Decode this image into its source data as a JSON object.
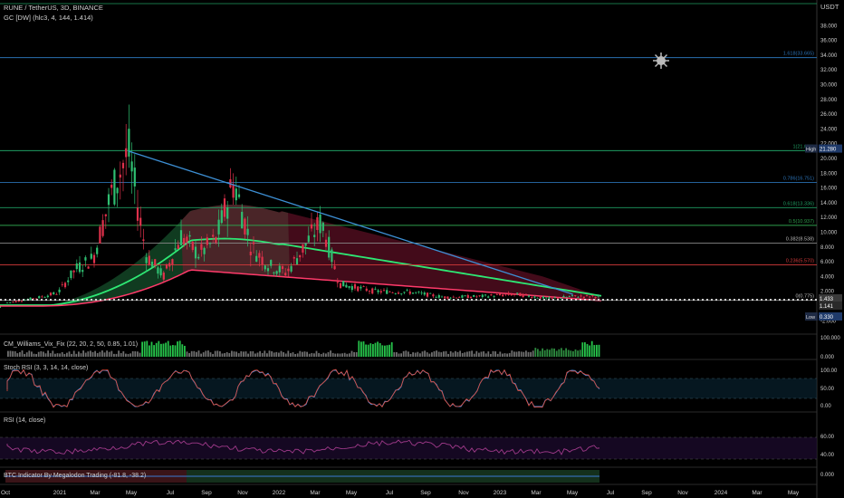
{
  "header": {
    "symbol_line": "RUNE / TetherUS, 3D, BINANCE",
    "indicator_line": "GC [DW] (hlc3, 4, 144, 1.414)"
  },
  "currency": "USDT",
  "colors": {
    "background": "#000000",
    "candle_up": "#2fbf71",
    "candle_down": "#e0314b",
    "trendline": "#3d8fd4",
    "band_green": "#2ee874",
    "band_red": "#ff3a6a"
  },
  "chart_data": [
    {
      "type": "candlestick",
      "title": "RUNE / TetherUS, 3D, BINANCE",
      "y_ticks": [
        "40.000",
        "38.000",
        "36.000",
        "34.000",
        "32.000",
        "30.000",
        "28.000",
        "26.000",
        "24.000",
        "22.000",
        "20.000",
        "18.000",
        "16.000",
        "14.000",
        "12.000",
        "10.000",
        "8.000",
        "6.000",
        "4.000",
        "2.000",
        "0.000",
        "-2.000"
      ],
      "ylim": [
        -2,
        41
      ],
      "x_ticks": [
        "Oct",
        "2021",
        "Mar",
        "May",
        "Jul",
        "Sep",
        "Nov",
        "2022",
        "Mar",
        "May",
        "Jul",
        "Sep",
        "Nov",
        "2023",
        "Mar",
        "May",
        "Jul",
        "Sep",
        "Nov",
        "2024",
        "Mar",
        "May"
      ],
      "approx_close_path": [
        {
          "t": "Oct 2020",
          "v": 0.4
        },
        {
          "t": "Dec 2020",
          "v": 1.2
        },
        {
          "t": "Jan 2021",
          "v": 1.8
        },
        {
          "t": "Feb 2021",
          "v": 5.0
        },
        {
          "t": "Mar 2021",
          "v": 6.5
        },
        {
          "t": "Apr 2021",
          "v": 15.0
        },
        {
          "t": "May 2021",
          "v": 21.0
        },
        {
          "t": "Jun 2021",
          "v": 7.0
        },
        {
          "t": "Jul 2021",
          "v": 4.0
        },
        {
          "t": "Aug 2021",
          "v": 9.5
        },
        {
          "t": "Sep 2021",
          "v": 7.0
        },
        {
          "t": "Oct 2021",
          "v": 9.0
        },
        {
          "t": "Nov 2021",
          "v": 17.0
        },
        {
          "t": "Dec 2021",
          "v": 8.0
        },
        {
          "t": "Jan 2022",
          "v": 5.5
        },
        {
          "t": "Feb 2022",
          "v": 4.5
        },
        {
          "t": "Mar 2022",
          "v": 8.0
        },
        {
          "t": "Apr 2022",
          "v": 11.5
        },
        {
          "t": "May 2022",
          "v": 3.0
        },
        {
          "t": "Jul 2022",
          "v": 2.0
        },
        {
          "t": "Sep 2022",
          "v": 1.9
        },
        {
          "t": "Nov 2022",
          "v": 1.2
        },
        {
          "t": "Jan 2023",
          "v": 1.3
        },
        {
          "t": "Mar 2023",
          "v": 1.6
        },
        {
          "t": "May 2023",
          "v": 1.0
        },
        {
          "t": "Jun 2023",
          "v": 1.3
        }
      ],
      "fib_levels": [
        {
          "label": "1.618(33.665)",
          "value": 33.665,
          "color": "#2a6fb0"
        },
        {
          "label": "1(21.059)",
          "value": 21.059,
          "color": "#1f9d62"
        },
        {
          "label": "0.786(16.751)",
          "value": 16.751,
          "color": "#2a6fb0"
        },
        {
          "label": "0.618(13.336)",
          "value": 13.336,
          "color": "#1f9d62"
        },
        {
          "label": "0.5(10.937)",
          "value": 10.937,
          "color": "#2e9e4c"
        },
        {
          "label": "0.382(8.538)",
          "value": 8.538,
          "color": "#888888"
        },
        {
          "label": "0.236(5.570)",
          "value": 5.57,
          "color": "#d43a3a"
        },
        {
          "label": "0(0.775)",
          "value": 0.775,
          "color": "#888888"
        }
      ],
      "price_tags": [
        {
          "name": "High",
          "value": "21.280"
        },
        {
          "name": "Low",
          "value": "0.330"
        },
        {
          "name": "Last",
          "value": "1.433"
        },
        {
          "name": "Last2",
          "value": "1.141"
        }
      ],
      "trendline": [
        {
          "t": "May 2021",
          "v": 21.0
        },
        {
          "t": "Jun 2023",
          "v": 1.6
        }
      ]
    },
    {
      "type": "bar",
      "title": "CM_Williams_Vix_Fix (22, 20, 2, 50, 0.85, 1.01)",
      "y_ticks": [
        "100.000",
        "0.000"
      ],
      "ylim": [
        0,
        100
      ]
    },
    {
      "type": "line",
      "title": "Stoch RSI (3, 3, 14, 14, close)",
      "y_ticks": [
        "100.00",
        "50.00",
        "0.00"
      ],
      "ylim": [
        0,
        100
      ],
      "band": [
        20,
        80
      ]
    },
    {
      "type": "line",
      "title": "RSI (14, close)",
      "y_ticks": [
        "60.00",
        "40.00"
      ],
      "ylim": [
        20,
        80
      ],
      "band": [
        30,
        70
      ]
    },
    {
      "type": "area",
      "title": "BTC Indicator By Megalodon Trading (-81.8, -38.2)",
      "y_ticks": [
        "0.000"
      ]
    }
  ]
}
